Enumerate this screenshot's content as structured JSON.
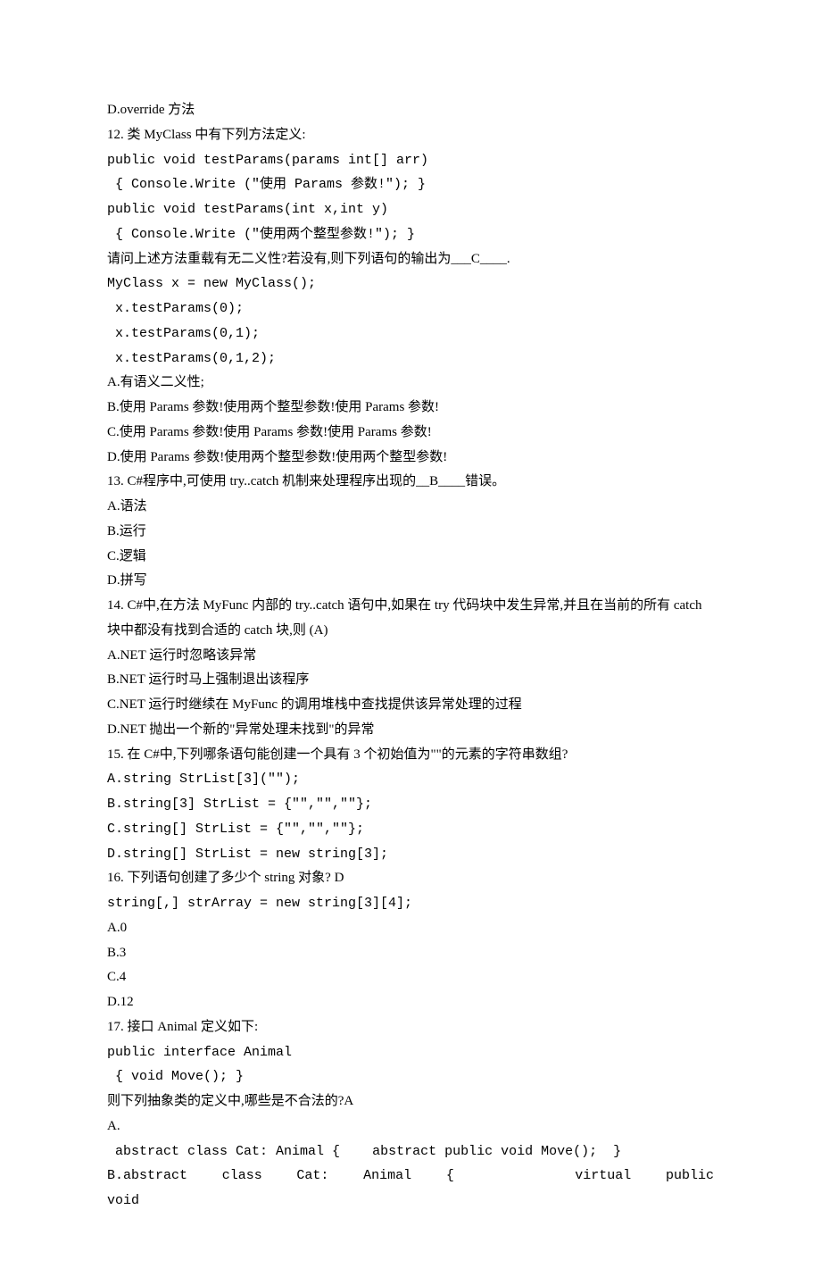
{
  "lines": [
    {
      "t": "D.override 方法",
      "cls": "line"
    },
    {
      "t": "12. 类 MyClass 中有下列方法定义:",
      "cls": "line"
    },
    {
      "t": "public void testParams(params int[] arr)",
      "cls": "line mono"
    },
    {
      "t": " { Console.Write (\"使用 Params 参数!\"); }",
      "cls": "line mono"
    },
    {
      "t": "public void testParams(int x,int y)",
      "cls": "line mono"
    },
    {
      "t": " { Console.Write (\"使用两个整型参数!\"); }",
      "cls": "line mono"
    },
    {
      "t": "请问上述方法重载有无二义性?若没有,则下列语句的输出为___C____.",
      "cls": "line"
    },
    {
      "t": "MyClass x = new MyClass();",
      "cls": "line mono"
    },
    {
      "t": " x.testParams(0);",
      "cls": "line mono"
    },
    {
      "t": " x.testParams(0,1);",
      "cls": "line mono"
    },
    {
      "t": " x.testParams(0,1,2);",
      "cls": "line mono"
    },
    {
      "t": "A.有语义二义性;",
      "cls": "line"
    },
    {
      "t": "B.使用 Params 参数!使用两个整型参数!使用 Params 参数!",
      "cls": "line"
    },
    {
      "t": "C.使用 Params 参数!使用 Params 参数!使用 Params 参数!",
      "cls": "line"
    },
    {
      "t": "D.使用 Params 参数!使用两个整型参数!使用两个整型参数!",
      "cls": "line"
    },
    {
      "t": "13. C#程序中,可使用 try..catch 机制来处理程序出现的__B____错误。",
      "cls": "line"
    },
    {
      "t": "A.语法",
      "cls": "line"
    },
    {
      "t": "B.运行",
      "cls": "line"
    },
    {
      "t": "C.逻辑",
      "cls": "line"
    },
    {
      "t": "D.拼写",
      "cls": "line"
    },
    {
      "t": "14. C#中,在方法 MyFunc 内部的 try..catch 语句中,如果在 try 代码块中发生异常,并且在当前的所有 catch 块中都没有找到合适的 catch 块,则 (A)",
      "cls": "line"
    },
    {
      "t": "A.NET 运行时忽略该异常",
      "cls": "line"
    },
    {
      "t": "B.NET 运行时马上强制退出该程序",
      "cls": "line"
    },
    {
      "t": "C.NET 运行时继续在 MyFunc 的调用堆栈中查找提供该异常处理的过程",
      "cls": "line"
    },
    {
      "t": "D.NET 抛出一个新的\"异常处理未找到\"的异常",
      "cls": "line"
    },
    {
      "t": "15. 在 C#中,下列哪条语句能创建一个具有 3 个初始值为\"\"的元素的字符串数组?",
      "cls": "line"
    },
    {
      "t": "A.string StrList[3](\"\");",
      "cls": "line mono"
    },
    {
      "t": "B.string[3] StrList = {\"\",\"\",\"\"};",
      "cls": "line mono"
    },
    {
      "t": "C.string[] StrList = {\"\",\"\",\"\"};",
      "cls": "line mono"
    },
    {
      "t": "D.string[] StrList = new string[3];",
      "cls": "line mono"
    },
    {
      "t": "16. 下列语句创建了多少个 string 对象? D",
      "cls": "line"
    },
    {
      "t": "string[,] strArray = new string[3][4];",
      "cls": "line mono"
    },
    {
      "t": "A.0",
      "cls": "line"
    },
    {
      "t": "B.3",
      "cls": "line"
    },
    {
      "t": "C.4",
      "cls": "line"
    },
    {
      "t": "D.12",
      "cls": "line"
    },
    {
      "t": "17. 接口 Animal 定义如下:",
      "cls": "line"
    },
    {
      "t": "public interface Animal",
      "cls": "line mono"
    },
    {
      "t": " { void Move(); }",
      "cls": "line mono"
    },
    {
      "t": "则下列抽象类的定义中,哪些是不合法的?A",
      "cls": "line"
    },
    {
      "t": "A.",
      "cls": "line"
    },
    {
      "t": " abstract class Cat: Animal {    abstract public void Move();  }",
      "cls": "line mono"
    },
    {
      "t": "B.abstract    class    Cat:    Animal    {              virtual    public    void",
      "cls": "line mono justify"
    }
  ]
}
